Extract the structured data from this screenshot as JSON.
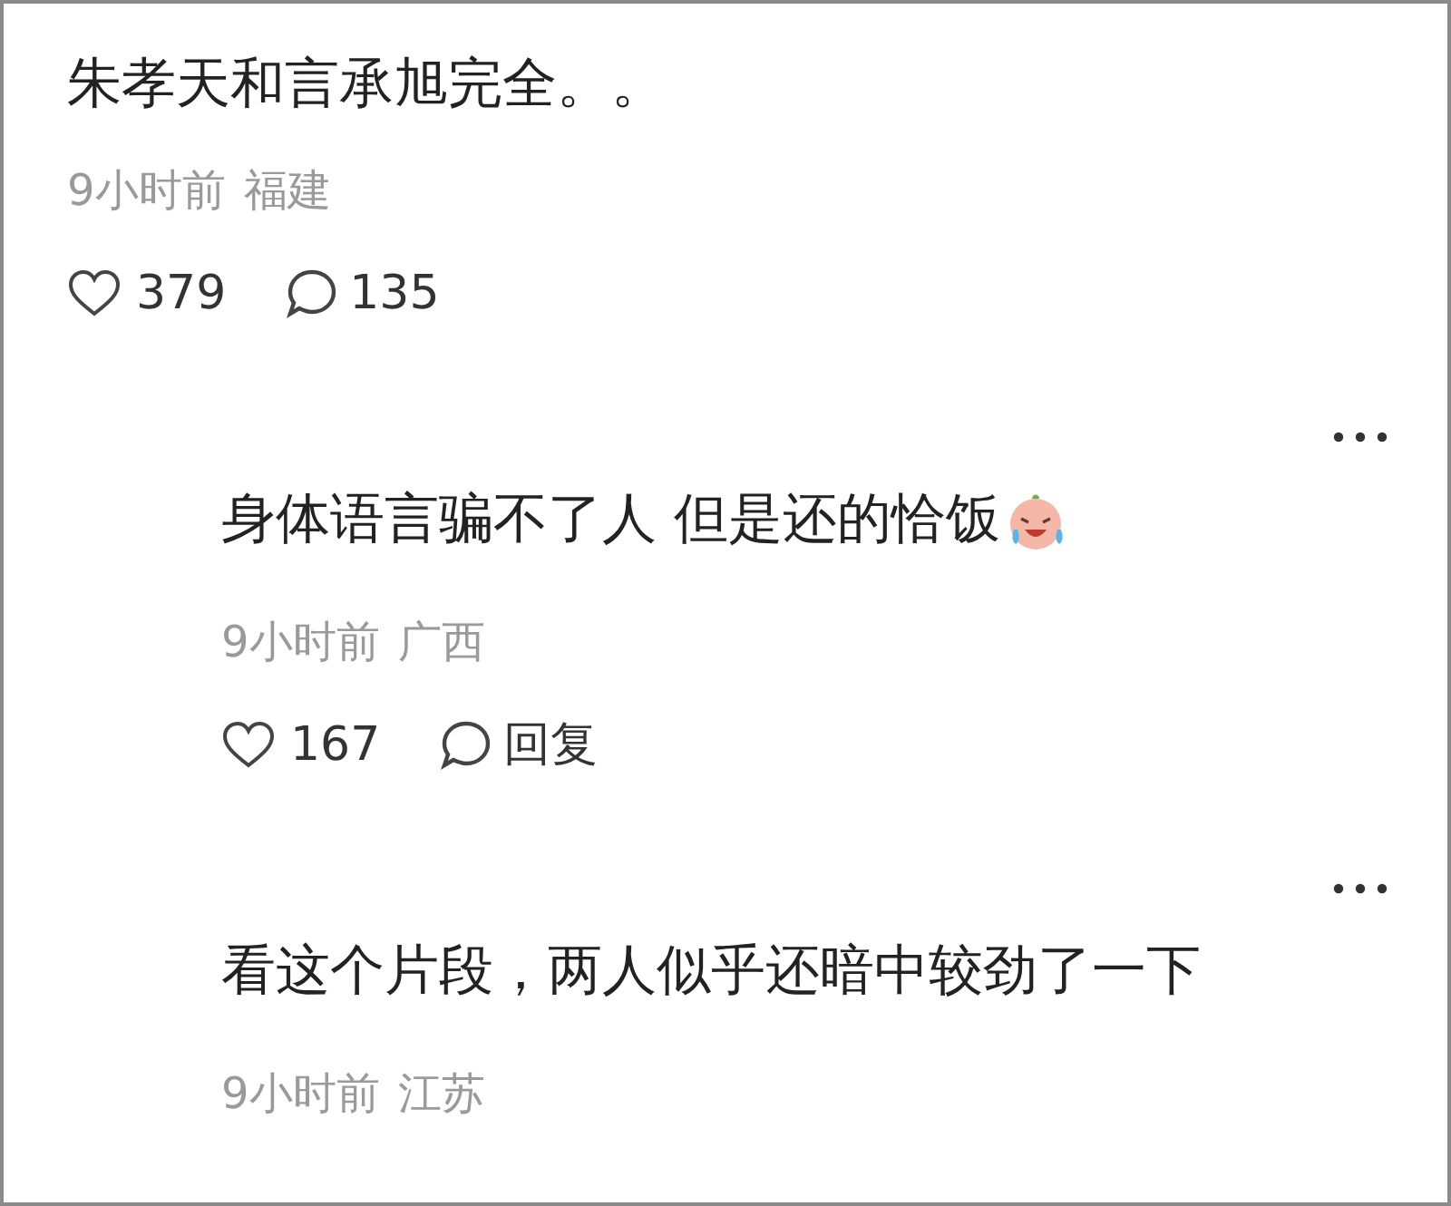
{
  "comments": [
    {
      "kind": "comment",
      "text": "朱孝天和言承旭完全。。",
      "time": "9小时前",
      "location": "福建",
      "likes": "379",
      "replies": "135"
    },
    {
      "kind": "reply",
      "text": "身体语言骗不了人 但是还的恰饭",
      "emoji": true,
      "time": "9小时前",
      "location": "广西",
      "likes": "167",
      "replies": "回复"
    },
    {
      "kind": "reply",
      "text": "看这个片段，两人似乎还暗中较劲了一下",
      "time": "9小时前",
      "location": "江苏"
    }
  ]
}
